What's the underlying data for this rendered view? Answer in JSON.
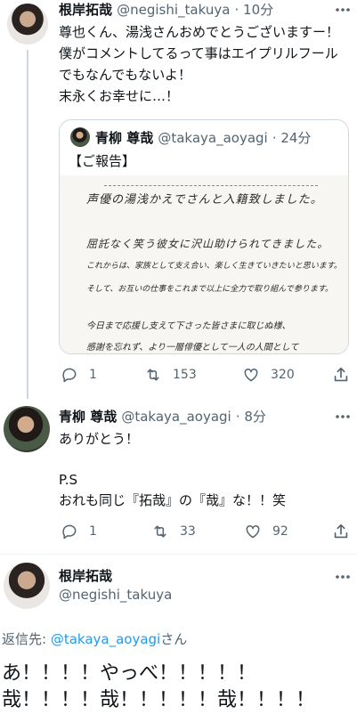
{
  "tweet1": {
    "author_name": "根岸拓哉",
    "handle": "@negishi_takuya",
    "time": "· 10分",
    "text": "尊也くん、湯浅さんおめでとうございますー！\n僕がコメントしてるって事はエイプリルフール\nでもなんでもないよ！\n末永くお幸せに…！",
    "quote": {
      "author_name": "青柳 尊哉",
      "handle": "@takaya_aoyagi",
      "time": "· 24分",
      "text": "【ご報告】",
      "handwriting": [
        "声優の湯浅かえでさんと入籍致しました。",
        "屈託なく笑う彼女に沢山助けられてきました。",
        "これからは、家族として支え合い、楽しく生きていきたいと思います。",
        "そして、お互いの仕事をこれまで以上に全力で取り組んで参ります。",
        "今日まで応援し支えて下さった皆さまに取じぬ様、",
        "感謝を忘れず、より一層俳優として一人の人間として"
      ]
    },
    "stats": {
      "replies": "1",
      "retweets": "153",
      "likes": "320"
    }
  },
  "tweet2": {
    "author_name": "青柳 尊哉",
    "handle": "@takaya_aoyagi",
    "time": "· 8分",
    "text": "ありがとう！\n\nP.S\nおれも同じ『拓哉』の『哉』な！！笑",
    "stats": {
      "replies": "1",
      "retweets": "33",
      "likes": "92"
    }
  },
  "reply": {
    "author_name": "根岸拓哉",
    "handle": "@negishi_takuya",
    "reply_prefix": "返信先: ",
    "reply_to": "@takaya_aoyagi",
    "reply_suffix": "さん",
    "line1": "あ！！！！やっべ！！！！！",
    "line2": "哉！！！！哉！！！！！哉！！！！"
  },
  "colors": {
    "link": "#1d9bf0",
    "secondary": "#536471",
    "divider": "#eff3f4"
  },
  "icons": [
    "reply-icon",
    "retweet-icon",
    "like-icon",
    "share-icon",
    "more-icon"
  ]
}
